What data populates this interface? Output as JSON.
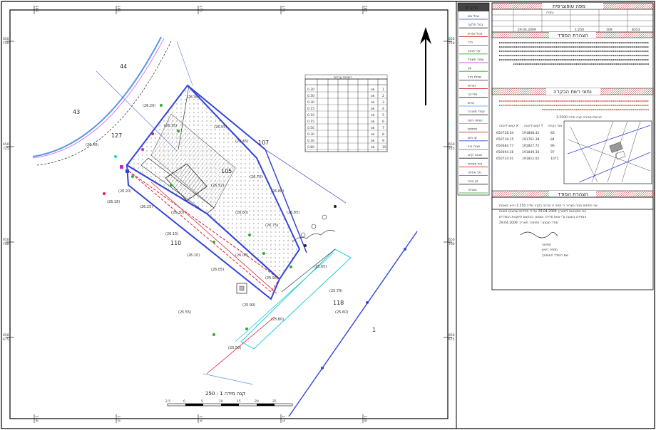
{
  "scale_bar": {
    "label": "קנה מידה  1 : 250",
    "ticks": [
      "2.5",
      "0",
      "5",
      "10",
      "15",
      "20",
      "25"
    ]
  },
  "grid_labels": {
    "top": [
      "160",
      "165",
      "170",
      "175",
      "180"
    ],
    "left": [
      "650\n750",
      "650\n725",
      "650\n700",
      "650\n675"
    ],
    "right": [
      "650\n750",
      "650\n725",
      "650\n700",
      "650\n675"
    ]
  },
  "parcels": [
    "44",
    "43",
    "127",
    "107",
    "105",
    "110",
    "118",
    "1"
  ],
  "area_table": {
    "title": "רשימת ערכים",
    "rows": [
      "1",
      "2",
      "3",
      "4",
      "5",
      "6",
      "7",
      "8",
      "9",
      "10"
    ],
    "values": [
      "0.30",
      "0.30",
      "0.30",
      "0.15",
      "0.10",
      "0.15",
      "0.50",
      "0.30",
      "0.30",
      "0.80"
    ]
  },
  "legend": {
    "title": "מקרא",
    "items": [
      "גבול גוש",
      "גבול חלקה",
      "גבול מגרש",
      "גדר",
      "קיר תומך",
      "עמוד חשמל",
      "עץ",
      "שוחת ביוב",
      "גבהים",
      "מדרכה",
      "כביש",
      "עמוד תאורה",
      "שוחת ניקוז",
      "מחסום",
      "קו מים",
      "שטח בנוי",
      "מבנה קיים",
      "בית תוכנית",
      "נק' אחיזה",
      "קו גובה",
      "צמחיה"
    ]
  },
  "info_panel": {
    "section1_title": "מפה טופוגרפית",
    "section2_title": "הצהרת המודד",
    "section3_title": "נתוני רשת הבקרה",
    "section4_title": "הצהרת המודד",
    "locality": "נתניה",
    "block": "8353",
    "parcel": "109",
    "scale": "1:250",
    "survey_date": "29.04.2009",
    "coord_title": "תרשים סביבה  קנה מידה 1:2500",
    "coord_headers": [
      "מס' נקודה",
      "קואורדינטה Y",
      "קואורדינטה X"
    ],
    "coords": [
      [
        "83",
        "191808.42",
        "650728.04"
      ],
      [
        "84",
        "191761.38",
        "650718.15"
      ],
      [
        "96",
        "191827.72",
        "650684.77"
      ],
      [
        "97",
        "191849.36",
        "650694.26"
      ],
      [
        "1071",
        "191812.02",
        "650724.01"
      ]
    ],
    "statement_lines": [
      "אני החתום מטה מצהיר כי מפה זו הוכנה בקנה מידה 1:250 והיא תואמת",
      "את המציאות לתאריך 29.04.2009 על פי מדידות שבוצעו בשטח",
      "המדידה בוצעה ע\"י צוות מדידה מוסמך בהתאם לתקנות המודדים",
      "מודד מוסמך:  חתימה:  תאריך: 29.04.2009"
    ],
    "surveyor_label": "שם המודד המוסמך",
    "license_label": "מספר רשיון",
    "sign_label": "חתימה"
  },
  "colors": {
    "parcel_border": "#3344dd",
    "road": "#5599ee",
    "red_line": "#dd2233",
    "magenta": "#cc22cc",
    "cyan": "#22ccdd",
    "green": "#33aa33",
    "black": "#111111"
  }
}
